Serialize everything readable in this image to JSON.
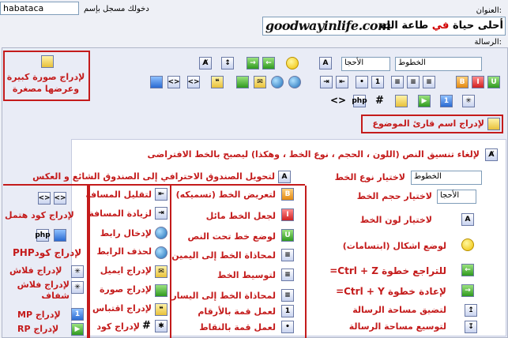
{
  "header": {
    "username": "habataca",
    "login_status": "دخولك مسجل بإسم",
    "title_label": "العنوان:",
    "subject_logo": "goodwayinlife.com",
    "subject_text_a": "أحلى حياة",
    "subject_text_red": "في",
    "subject_text_b": "طاعة الله",
    "message_label": "الرسالة:"
  },
  "toolbar": {
    "font_select": "الخطوط",
    "size_select": "الأحجا",
    "font_select2": "الخطوط",
    "size_select2": "الأحجا"
  },
  "annotations": {
    "big_image": "لإدراج صورة كبيرة وعرضها مصغرة",
    "reader_name": "لإدراج اسم قارئ الموضوع",
    "remove_format": "لإلغاء تنسيق النص (اللون ، الحجم ، نوع الخط ، وهكذا) ليصبح بالخط الافتراضى",
    "convert_box": "لتحويل الصندوق الاحترافي إلى الصندوق الشائع و العكس",
    "font_type": "لاختيار نوع الخط",
    "font_size": "لاختيار حجم الخط",
    "font_color": "لاختيار لون الخط",
    "smilies": "لوضع اشكال (ابتسامات)",
    "undo": "للتراجع خطوة Ctrl + Z=",
    "redo": "لإعادة خطوة Ctrl + Y=",
    "shrink": "لتضيق مساحة الرسالة",
    "expand": "لتوسيع مساحة الرسالة",
    "bold": "لتعريض الخط (تسميكه)",
    "italic": "لجعل الخط مائل",
    "underline": "لوضع خط تحت النص",
    "align_right": "لمحاذاة الخط إلى اليمين",
    "center": "لتوسيط الخط",
    "align_left": "لمحاذاة الخط إلى اليسار",
    "ordered_list": "لعمل قمة بالأرقام",
    "bullet_list": "لعمل قمة بالنقاط",
    "outdent": "لتقليل المسافة",
    "indent": "لزيادة المسافة",
    "link": "لإدخال رابط",
    "unlink": "لحذف الرابط",
    "email": "لإدراج ايميل",
    "image": "لإدراج صورة",
    "quote": "لإدراج اقتباس",
    "code": "لإدراج كود",
    "html": "لإدراج كود هتمل",
    "php": "لإدراج كودPHP",
    "flash": "لإدراج فلاش",
    "flash_trans": "لإدراج فلاش شفاف",
    "mp": "لإدراج MP",
    "rp": "لإدراج RP"
  },
  "colors": {
    "accent_red": "#c41b1b",
    "panel_bg": "#e9ecf6",
    "white": "#ffffff"
  }
}
